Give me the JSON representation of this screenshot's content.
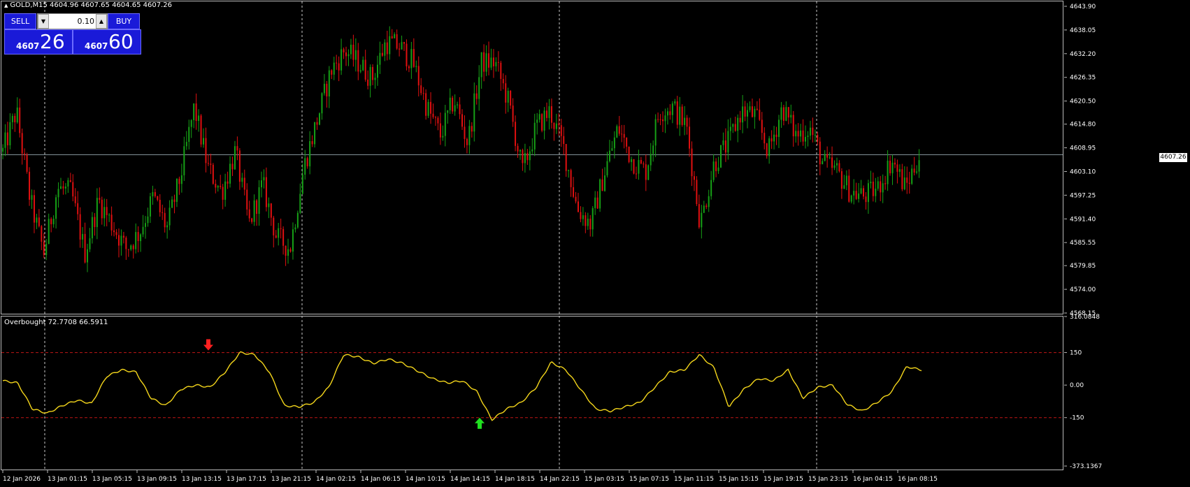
{
  "header": {
    "symbol": "GOLD,M15",
    "ohlc": "4604.96 4607.65 4604.65 4607.26"
  },
  "trade_panel": {
    "sell_label": "SELL",
    "buy_label": "BUY",
    "lot": "0.10",
    "sell_small": "4607",
    "sell_big": "26",
    "buy_small": "4607",
    "buy_big": "60"
  },
  "indicator": {
    "label": "Overbought 72.7708 66.5911"
  },
  "colors": {
    "bull": "#16a016",
    "bear": "#e01010",
    "line": "#f3d51b",
    "level": "#c01616",
    "grid": "#c8c8c8"
  },
  "chart_data": [
    {
      "type": "candlestick",
      "symbol": "GOLD",
      "timeframe": "M15",
      "y_ticks": [
        "4643.90",
        "4638.05",
        "4632.20",
        "4626.35",
        "4620.50",
        "4614.80",
        "4608.95",
        "4603.10",
        "4597.25",
        "4591.40",
        "4585.55",
        "4579.85",
        "4574.00",
        "4568.15"
      ],
      "ylim": [
        4568.15,
        4643.9
      ],
      "current_price": "4607.26",
      "x_ticks": [
        "12 Jan 2026",
        "13 Jan 01:15",
        "13 Jan 05:15",
        "13 Jan 09:15",
        "13 Jan 13:15",
        "13 Jan 17:15",
        "13 Jan 21:15",
        "14 Jan 02:15",
        "14 Jan 06:15",
        "14 Jan 10:15",
        "14 Jan 14:15",
        "14 Jan 18:15",
        "14 Jan 22:15",
        "15 Jan 03:15",
        "15 Jan 07:15",
        "15 Jan 11:15",
        "15 Jan 15:15",
        "15 Jan 19:15",
        "15 Jan 23:15",
        "16 Jan 04:15",
        "16 Jan 08:15"
      ],
      "close_path": [
        4608,
        4618,
        4596,
        4583,
        4599,
        4598,
        4583,
        4596,
        4590,
        4584,
        4588,
        4597,
        4589,
        4602,
        4619,
        4604,
        4598,
        4608,
        4590,
        4600,
        4587,
        4584,
        4604,
        4616,
        4628,
        4633,
        4630,
        4626,
        4635,
        4634,
        4630,
        4619,
        4612,
        4621,
        4610,
        4630,
        4630,
        4620,
        4603,
        4614,
        4618,
        4609,
        4594,
        4590,
        4603,
        4614,
        4606,
        4603,
        4618,
        4619,
        4614,
        4590,
        4605,
        4610,
        4618,
        4617,
        4608,
        4619,
        4612,
        4614,
        4605,
        4603,
        4598,
        4597,
        4599,
        4606,
        4599,
        4607
      ]
    },
    {
      "type": "line",
      "name": "Overbought",
      "values_shown": [
        "72.7708",
        "66.5911"
      ],
      "levels": [
        150,
        -150
      ],
      "y_ticks": [
        "316.0848",
        "150",
        "0.00",
        "-150",
        "-373.1367"
      ],
      "ylim": [
        -373.1367,
        316.0848
      ],
      "path": [
        20,
        10,
        -110,
        -130,
        -95,
        -70,
        -85,
        40,
        70,
        60,
        -60,
        -95,
        -20,
        0,
        -10,
        60,
        150,
        140,
        60,
        -95,
        -100,
        -80,
        -10,
        140,
        130,
        100,
        120,
        100,
        65,
        30,
        10,
        20,
        -30,
        -160,
        -110,
        -80,
        -10,
        105,
        70,
        -20,
        -110,
        -120,
        -100,
        -80,
        -10,
        60,
        70,
        140,
        80,
        -100,
        -20,
        30,
        20,
        70,
        -60,
        -10,
        0,
        -90,
        -120,
        -80,
        -30,
        85,
        70
      ],
      "signals": [
        {
          "kind": "sell",
          "at": "13 Jan 13:15"
        },
        {
          "kind": "buy",
          "at": "14 Jan 14:15"
        }
      ]
    }
  ]
}
